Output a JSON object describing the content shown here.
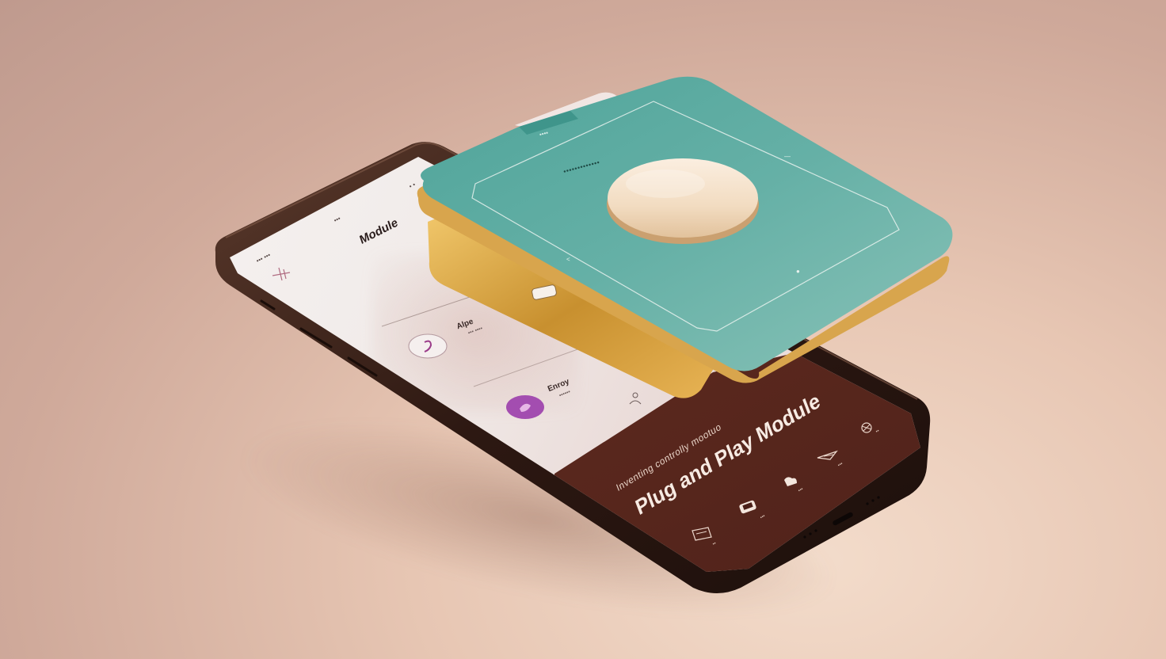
{
  "screen": {
    "title": "Module",
    "status": {
      "left": "••• •••",
      "middle": "•••",
      "right": "• •"
    },
    "list": [
      {
        "title": "Alpe",
        "subtitle": "••• ••••"
      },
      {
        "title": "Enroy",
        "subtitle": "••••••"
      }
    ]
  },
  "banner": {
    "subtitle": "Inventing controlly mootuo",
    "title": "Plug and Play Module"
  },
  "card": {
    "header": "••••",
    "label": "•••••••••••••"
  },
  "nav": [
    "••",
    "•••",
    "•••",
    "•••",
    "••"
  ],
  "colors": {
    "background": "#d9b6a6",
    "card_teal": "#5fa9a0",
    "card_gold": "#d6a24a",
    "screen_dark": "#5e2a1f",
    "phone_frame": "#3a1f18",
    "accent_purple": "#a34db0"
  },
  "icons": [
    "plus-icon",
    "heart-icon",
    "bell-icon",
    "document-icon",
    "cloud-icon",
    "bag-icon",
    "bird-icon",
    "cake-icon"
  ]
}
